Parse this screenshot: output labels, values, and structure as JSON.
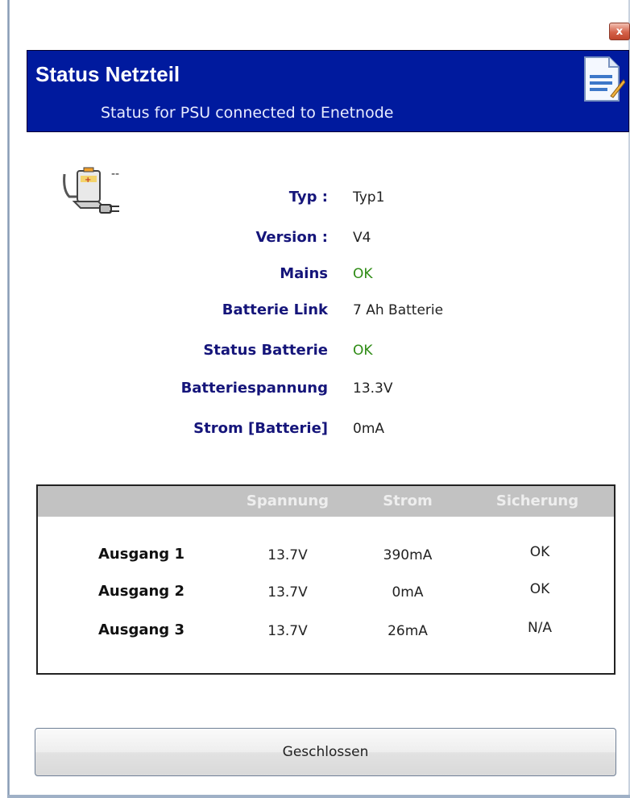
{
  "window": {
    "close_glyph": "x"
  },
  "header": {
    "title": "Status Netzteil",
    "subtitle": "Status for PSU connected to Enetnode",
    "icon": "document-edit-icon",
    "background": "#001a9e"
  },
  "psu": {
    "icon": "battery-plug-icon",
    "icon_suffix": "--",
    "rows": [
      {
        "label": "Typ :",
        "value": "Typ1"
      },
      {
        "label": "Version :",
        "value": "V4"
      },
      {
        "label": "Mains",
        "value": "OK"
      },
      {
        "label": "Batterie Link",
        "value": "7 Ah Batterie"
      },
      {
        "label": "Status Batterie",
        "value": "OK"
      },
      {
        "label": "Batteriespannung",
        "value": "13.3V"
      },
      {
        "label": "Strom [Batterie]",
        "value": "0mA"
      }
    ]
  },
  "outputs": {
    "headers": [
      "Spannung",
      "Strom",
      "Sicherung"
    ],
    "rows": [
      {
        "label": "Ausgang 1",
        "spannung": "13.7V",
        "strom": "390mA",
        "sicherung": "OK"
      },
      {
        "label": "Ausgang 2",
        "spannung": "13.7V",
        "strom": "0mA",
        "sicherung": "OK"
      },
      {
        "label": "Ausgang 3",
        "spannung": "13.7V",
        "strom": "26mA",
        "sicherung": "N/A"
      }
    ]
  },
  "footer": {
    "button_label": "Geschlossen"
  },
  "colors": {
    "label": "#15157a",
    "ok": "#2e8b14",
    "header_bar": "#c2c2c2"
  }
}
